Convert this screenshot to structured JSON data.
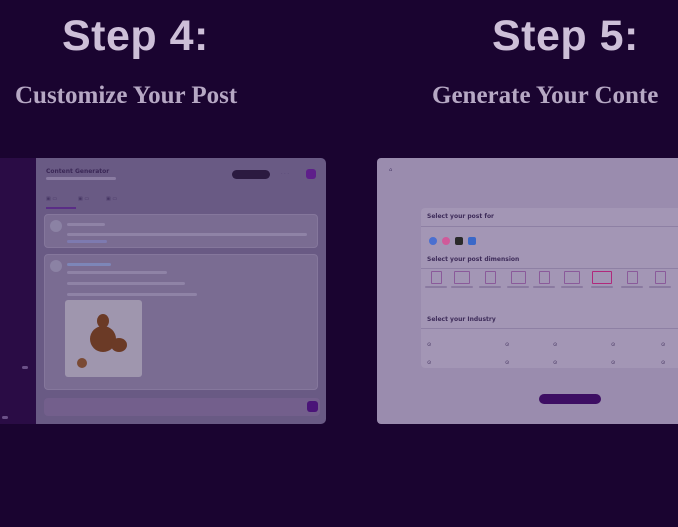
{
  "step4": {
    "title": "Step 4:",
    "subtitle": "Customize Your Post",
    "app": {
      "title": "Content Generator",
      "tabs": [
        "",
        "",
        ""
      ],
      "composer_placeholder": ""
    }
  },
  "step5": {
    "title": "Step 5:",
    "subtitle": "Generate Your Conte",
    "form": {
      "back_label": "",
      "section_platform": "Select your post for",
      "section_dimension": "Select your post dimension",
      "section_industry": "Select your Industry",
      "platforms": [
        "facebook",
        "instagram",
        "x",
        "linkedin"
      ],
      "platform_colors": [
        "#4a6fd0",
        "#d05a9a",
        "#2a2a2a",
        "#3a68c8"
      ],
      "industries": [
        "",
        "",
        "",
        "",
        "",
        "",
        "",
        "",
        "",
        ""
      ]
    }
  },
  "colors": {
    "background": "#1a0430",
    "accent": "#5e1f8a"
  }
}
